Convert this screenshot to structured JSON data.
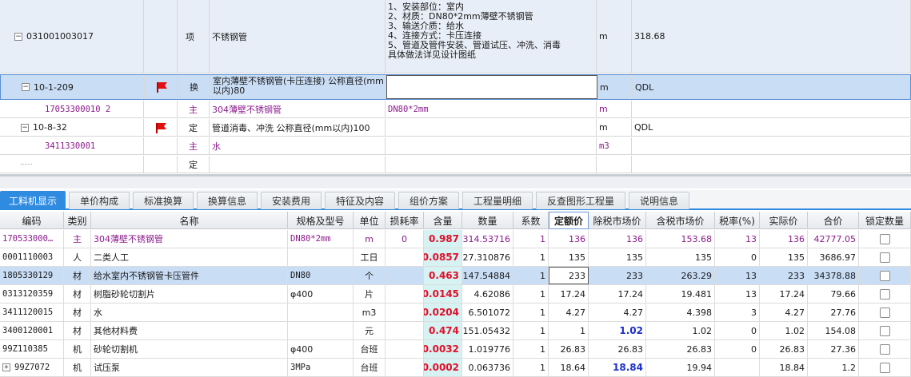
{
  "upper": {
    "rows": [
      {
        "code": "031001003017",
        "type": "项",
        "name": "不锈钢管",
        "feature": "1、安装部位：室内\n2、材质：DN80*2mm薄壁不锈钢管\n3、输送介质：给水\n4、连接方式：卡压连接\n5、管道及管件安装、管道试压、冲洗、消毒\n具体做法详见设计图纸",
        "unit": "m",
        "qty": "318.68",
        "expand": "−"
      },
      {
        "code": "10-1-209",
        "type": "换",
        "name": "室内薄壁不锈钢管(卡压连接) 公称直径(mm以内)80",
        "feature": "",
        "unit": "m",
        "qty": "QDL",
        "expand": "−"
      },
      {
        "code": "17053300010 2",
        "type": "主",
        "name": "304薄壁不锈钢管",
        "feature": "DN80*2mm",
        "unit": "m",
        "qty": ""
      },
      {
        "code": "10-8-32",
        "type": "定",
        "name": "管道消毒、冲洗 公称直径(mm以内)100",
        "feature": "",
        "unit": "m",
        "qty": "QDL",
        "expand": "−"
      },
      {
        "code": "3411330001",
        "type": "主",
        "name": "水",
        "feature": "",
        "unit": "m3",
        "qty": ""
      },
      {
        "code": "",
        "type": "定",
        "name": "",
        "feature": "",
        "unit": "",
        "qty": ""
      }
    ]
  },
  "tabs": [
    "工料机显示",
    "单价构成",
    "标准换算",
    "换算信息",
    "安装费用",
    "特征及内容",
    "组价方案",
    "工程量明细",
    "反查图形工程量",
    "说明信息"
  ],
  "grid": {
    "headers": [
      "编码",
      "类别",
      "名称",
      "规格及型号",
      "单位",
      "损耗率",
      "含量",
      "数量",
      "系数",
      "定额价",
      "除税市场价",
      "含税市场价",
      "税率(%)",
      "实际价",
      "合价",
      "锁定数量"
    ],
    "rows": [
      {
        "code": "170533000…",
        "cat": "主",
        "name": "304薄壁不锈钢管",
        "spec": "DN80*2mm",
        "unit": "m",
        "loss": "0",
        "content": "0.987",
        "qty": "314.53716",
        "coef": "1",
        "quota": "136",
        "mkt_ex": "136",
        "mkt_in": "153.68",
        "tax": "13",
        "actual": "136",
        "total": "42777.05"
      },
      {
        "code": "0001110003",
        "cat": "人",
        "name": "二类人工",
        "spec": "",
        "unit": "工日",
        "loss": "",
        "content": "0.0857",
        "qty": "27.310876",
        "coef": "1",
        "quota": "135",
        "mkt_ex": "135",
        "mkt_in": "135",
        "tax": "0",
        "actual": "135",
        "total": "3686.97"
      },
      {
        "code": "1805330129",
        "cat": "材",
        "name": "给水室内不锈钢管卡压管件",
        "spec": "DN80",
        "unit": "个",
        "loss": "",
        "content": "0.463",
        "qty": "147.54884",
        "coef": "1",
        "quota": "233",
        "mkt_ex": "233",
        "mkt_in": "263.29",
        "tax": "13",
        "actual": "233",
        "total": "34378.88"
      },
      {
        "code": "0313120359",
        "cat": "材",
        "name": "树脂砂轮切割片",
        "spec": "φ400",
        "unit": "片",
        "loss": "",
        "content": "0.0145",
        "qty": "4.62086",
        "coef": "1",
        "quota": "17.24",
        "mkt_ex": "17.24",
        "mkt_in": "19.481",
        "tax": "13",
        "actual": "17.24",
        "total": "79.66"
      },
      {
        "code": "3411120015",
        "cat": "材",
        "name": "水",
        "spec": "",
        "unit": "m3",
        "loss": "",
        "content": "0.0204",
        "qty": "6.501072",
        "coef": "1",
        "quota": "4.27",
        "mkt_ex": "4.27",
        "mkt_in": "4.398",
        "tax": "3",
        "actual": "4.27",
        "total": "27.76"
      },
      {
        "code": "3400120001",
        "cat": "材",
        "name": "其他材料费",
        "spec": "",
        "unit": "元",
        "loss": "",
        "content": "0.474",
        "qty": "151.05432",
        "coef": "1",
        "quota": "1",
        "mkt_ex": "1.02",
        "mkt_in": "1.02",
        "tax": "0",
        "actual": "1.02",
        "total": "154.08"
      },
      {
        "code": "99Z110385",
        "cat": "机",
        "name": "砂轮切割机",
        "spec": "φ400",
        "unit": "台班",
        "loss": "",
        "content": "0.0032",
        "qty": "1.019776",
        "coef": "1",
        "quota": "26.83",
        "mkt_ex": "26.83",
        "mkt_in": "26.83",
        "tax": "0",
        "actual": "26.83",
        "total": "27.36"
      },
      {
        "code": "99Z7072",
        "cat": "机",
        "name": "试压泵",
        "spec": "3MPa",
        "unit": "台班",
        "loss": "",
        "content": "0.0002",
        "qty": "0.063736",
        "coef": "1",
        "quota": "18.64",
        "mkt_ex": "18.84",
        "mkt_in": "19.94",
        "tax": "",
        "actual": "18.84",
        "total": "1.2"
      }
    ]
  },
  "colors": {
    "accent": "#2f8be0",
    "selected_row": "#c9ddf5",
    "purple": "#8b1a8b",
    "qty_red": "#e0102a",
    "flag_red": "#e01010"
  }
}
